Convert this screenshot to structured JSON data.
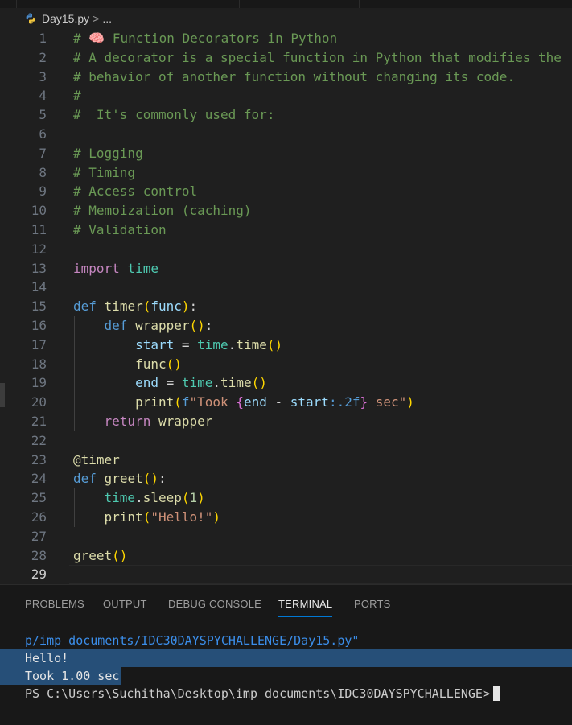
{
  "breadcrumb": {
    "file": "Day15.py",
    "separator": ">",
    "more": "..."
  },
  "editor": {
    "lines": [
      {
        "n": "1",
        "tokens": [
          {
            "t": "# 🧠 Function Decorators in Python",
            "c": "comment"
          }
        ]
      },
      {
        "n": "2",
        "tokens": [
          {
            "t": "# A decorator is a special function in Python that modifies the",
            "c": "comment"
          }
        ]
      },
      {
        "n": "3",
        "tokens": [
          {
            "t": "# behavior of another function without changing its code.",
            "c": "comment"
          }
        ]
      },
      {
        "n": "4",
        "tokens": [
          {
            "t": "#",
            "c": "comment"
          }
        ]
      },
      {
        "n": "5",
        "tokens": [
          {
            "t": "#  It's commonly used for:",
            "c": "comment"
          }
        ]
      },
      {
        "n": "6",
        "tokens": []
      },
      {
        "n": "7",
        "tokens": [
          {
            "t": "# Logging",
            "c": "comment"
          }
        ]
      },
      {
        "n": "8",
        "tokens": [
          {
            "t": "# Timing",
            "c": "comment"
          }
        ]
      },
      {
        "n": "9",
        "tokens": [
          {
            "t": "# Access control",
            "c": "comment"
          }
        ]
      },
      {
        "n": "10",
        "tokens": [
          {
            "t": "# Memoization (caching)",
            "c": "comment"
          }
        ]
      },
      {
        "n": "11",
        "tokens": [
          {
            "t": "# Validation",
            "c": "comment"
          }
        ]
      },
      {
        "n": "12",
        "tokens": []
      },
      {
        "n": "13",
        "tokens": [
          {
            "t": "import",
            "c": "ctrl"
          },
          {
            "t": " ",
            "c": "plain"
          },
          {
            "t": "time",
            "c": "mod"
          }
        ]
      },
      {
        "n": "14",
        "tokens": []
      },
      {
        "n": "15",
        "tokens": [
          {
            "t": "def",
            "c": "kw"
          },
          {
            "t": " ",
            "c": "plain"
          },
          {
            "t": "timer",
            "c": "fn"
          },
          {
            "t": "(",
            "c": "br1"
          },
          {
            "t": "func",
            "c": "var"
          },
          {
            "t": ")",
            "c": "br1"
          },
          {
            "t": ":",
            "c": "plain"
          }
        ]
      },
      {
        "n": "16",
        "tokens": [
          {
            "t": "    ",
            "c": "plain"
          },
          {
            "t": "def",
            "c": "kw"
          },
          {
            "t": " ",
            "c": "plain"
          },
          {
            "t": "wrapper",
            "c": "fn"
          },
          {
            "t": "()",
            "c": "br1"
          },
          {
            "t": ":",
            "c": "plain"
          }
        ]
      },
      {
        "n": "17",
        "tokens": [
          {
            "t": "        ",
            "c": "plain"
          },
          {
            "t": "start",
            "c": "var"
          },
          {
            "t": " = ",
            "c": "op"
          },
          {
            "t": "time",
            "c": "mod"
          },
          {
            "t": ".",
            "c": "plain"
          },
          {
            "t": "time",
            "c": "fn"
          },
          {
            "t": "()",
            "c": "br1"
          }
        ]
      },
      {
        "n": "18",
        "tokens": [
          {
            "t": "        ",
            "c": "plain"
          },
          {
            "t": "func",
            "c": "fn"
          },
          {
            "t": "()",
            "c": "br1"
          }
        ]
      },
      {
        "n": "19",
        "tokens": [
          {
            "t": "        ",
            "c": "plain"
          },
          {
            "t": "end",
            "c": "var"
          },
          {
            "t": " = ",
            "c": "op"
          },
          {
            "t": "time",
            "c": "mod"
          },
          {
            "t": ".",
            "c": "plain"
          },
          {
            "t": "time",
            "c": "fn"
          },
          {
            "t": "()",
            "c": "br1"
          }
        ]
      },
      {
        "n": "20",
        "tokens": [
          {
            "t": "        ",
            "c": "plain"
          },
          {
            "t": "print",
            "c": "fn"
          },
          {
            "t": "(",
            "c": "br1"
          },
          {
            "t": "f",
            "c": "kw"
          },
          {
            "t": "\"Took ",
            "c": "str"
          },
          {
            "t": "{",
            "c": "br2"
          },
          {
            "t": "end",
            "c": "var"
          },
          {
            "t": " - ",
            "c": "op"
          },
          {
            "t": "start",
            "c": "var"
          },
          {
            "t": ":.2f",
            "c": "fmt"
          },
          {
            "t": "}",
            "c": "br2"
          },
          {
            "t": " sec\"",
            "c": "str"
          },
          {
            "t": ")",
            "c": "br1"
          }
        ]
      },
      {
        "n": "21",
        "tokens": [
          {
            "t": "    ",
            "c": "plain"
          },
          {
            "t": "return",
            "c": "ctrl"
          },
          {
            "t": " ",
            "c": "plain"
          },
          {
            "t": "wrapper",
            "c": "fn"
          }
        ]
      },
      {
        "n": "22",
        "tokens": []
      },
      {
        "n": "23",
        "tokens": [
          {
            "t": "@timer",
            "c": "fn"
          }
        ]
      },
      {
        "n": "24",
        "tokens": [
          {
            "t": "def",
            "c": "kw"
          },
          {
            "t": " ",
            "c": "plain"
          },
          {
            "t": "greet",
            "c": "fn"
          },
          {
            "t": "()",
            "c": "br1"
          },
          {
            "t": ":",
            "c": "plain"
          }
        ]
      },
      {
        "n": "25",
        "tokens": [
          {
            "t": "    ",
            "c": "plain"
          },
          {
            "t": "time",
            "c": "mod"
          },
          {
            "t": ".",
            "c": "plain"
          },
          {
            "t": "sleep",
            "c": "fn"
          },
          {
            "t": "(",
            "c": "br1"
          },
          {
            "t": "1",
            "c": "num"
          },
          {
            "t": ")",
            "c": "br1"
          }
        ]
      },
      {
        "n": "26",
        "tokens": [
          {
            "t": "    ",
            "c": "plain"
          },
          {
            "t": "print",
            "c": "fn"
          },
          {
            "t": "(",
            "c": "br1"
          },
          {
            "t": "\"Hello!\"",
            "c": "str"
          },
          {
            "t": ")",
            "c": "br1"
          }
        ]
      },
      {
        "n": "27",
        "tokens": []
      },
      {
        "n": "28",
        "tokens": [
          {
            "t": "greet",
            "c": "fn"
          },
          {
            "t": "()",
            "c": "br1"
          }
        ]
      },
      {
        "n": "29",
        "tokens": []
      }
    ],
    "active_line": "29"
  },
  "panel": {
    "tabs": [
      "PROBLEMS",
      "OUTPUT",
      "DEBUG CONSOLE",
      "TERMINAL",
      "PORTS"
    ],
    "active_tab": "TERMINAL",
    "terminal": {
      "path_line": "p/imp documents/IDC30DAYSPYCHALLENGE/Day15.py\"",
      "output": [
        "Hello!",
        "Took 1.00 sec"
      ],
      "prompt": "PS C:\\Users\\Suchitha\\Desktop\\imp documents\\IDC30DAYSPYCHALLENGE>"
    }
  },
  "colors": {
    "comment": "#6a9955",
    "keyword": "#569cd6",
    "control": "#c586c0",
    "function": "#dcdcaa",
    "variable": "#9cdcfe",
    "module": "#4ec9b0",
    "string": "#ce9178",
    "number": "#b5cea8",
    "accent": "#0078d4",
    "selection": "#264f78"
  }
}
